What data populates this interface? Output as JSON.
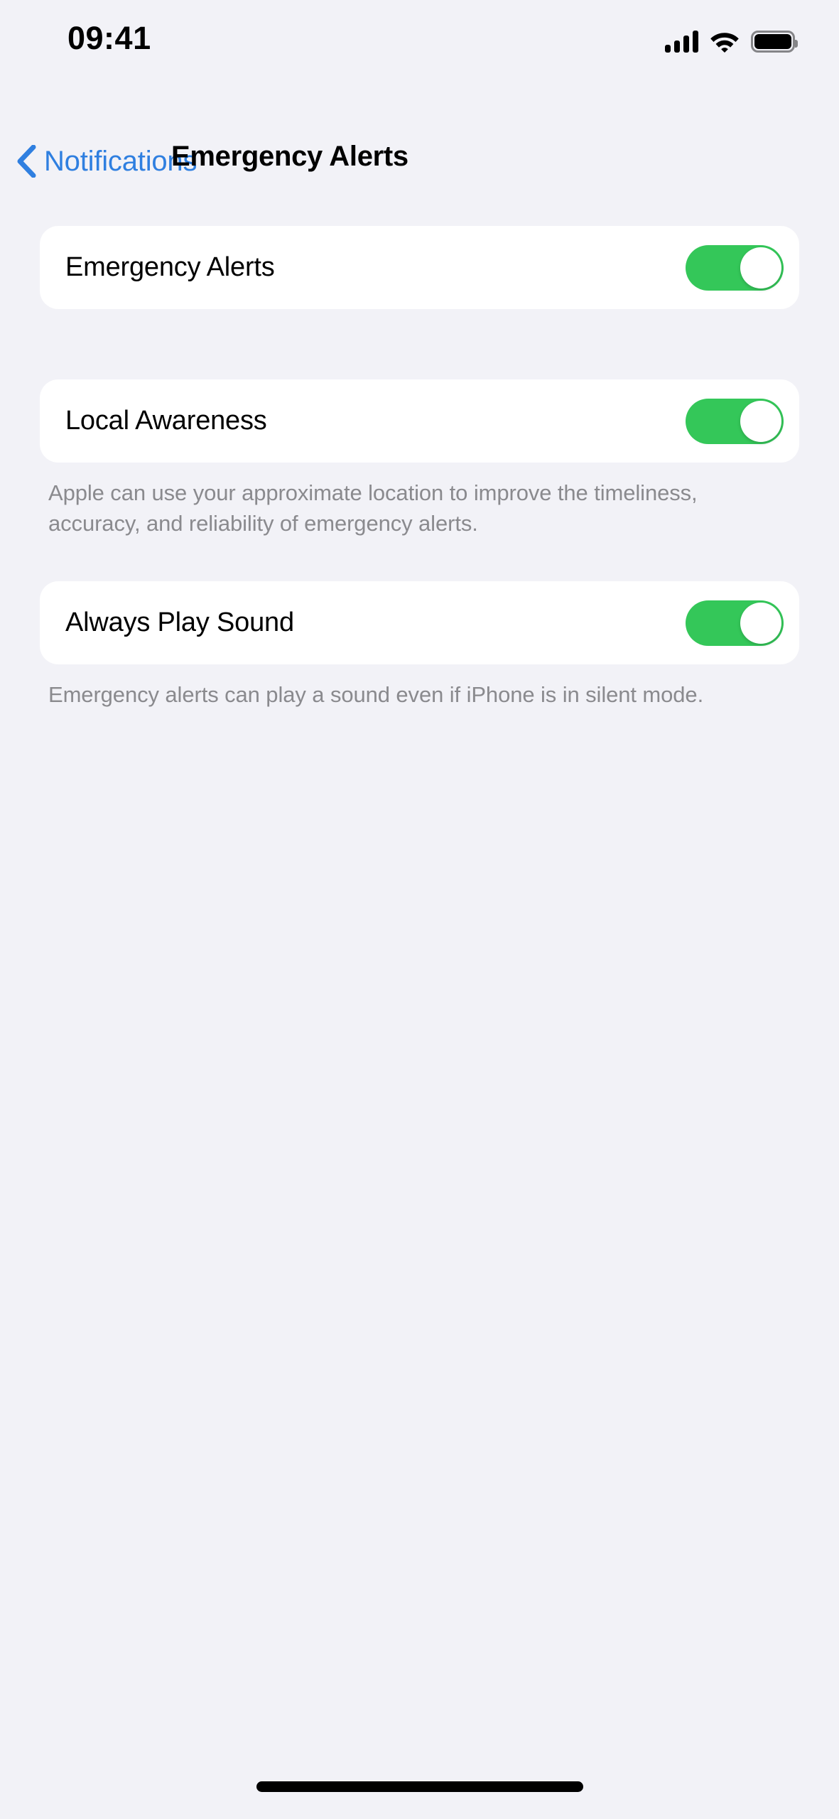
{
  "status_bar": {
    "time": "09:41",
    "cellular_icon": "cellular-signal-icon",
    "cellular_bars_filled": 4,
    "wifi_icon": "wifi-icon",
    "battery_icon": "battery-full-icon",
    "battery_level": "100"
  },
  "nav": {
    "back_icon": "chevron-left-icon",
    "back_label": "Notifications",
    "title": "Emergency Alerts"
  },
  "sections": [
    {
      "id": "emergency-alerts",
      "row_label": "Emergency Alerts",
      "toggle_name": "emergency-alerts-toggle",
      "toggle_state": "on",
      "footer": ""
    },
    {
      "id": "local-awareness",
      "row_label": "Local Awareness",
      "toggle_name": "local-awareness-toggle",
      "toggle_state": "on",
      "footer": "Apple can use your approximate location to improve the timeliness, accuracy, and reliability of emergency alerts."
    },
    {
      "id": "always-play-sound",
      "row_label": "Always Play Sound",
      "toggle_name": "always-play-sound-toggle",
      "toggle_state": "on",
      "footer": "Emergency alerts can play a sound even if iPhone is in silent mode."
    }
  ],
  "colors": {
    "background": "#F2F2F7",
    "card": "#FFFFFF",
    "accent_blue": "#2F7FE0",
    "toggle_green": "#34C759",
    "footer_gray": "#8A8A8E",
    "primary_text": "#000000"
  },
  "home_indicator": "home-indicator"
}
